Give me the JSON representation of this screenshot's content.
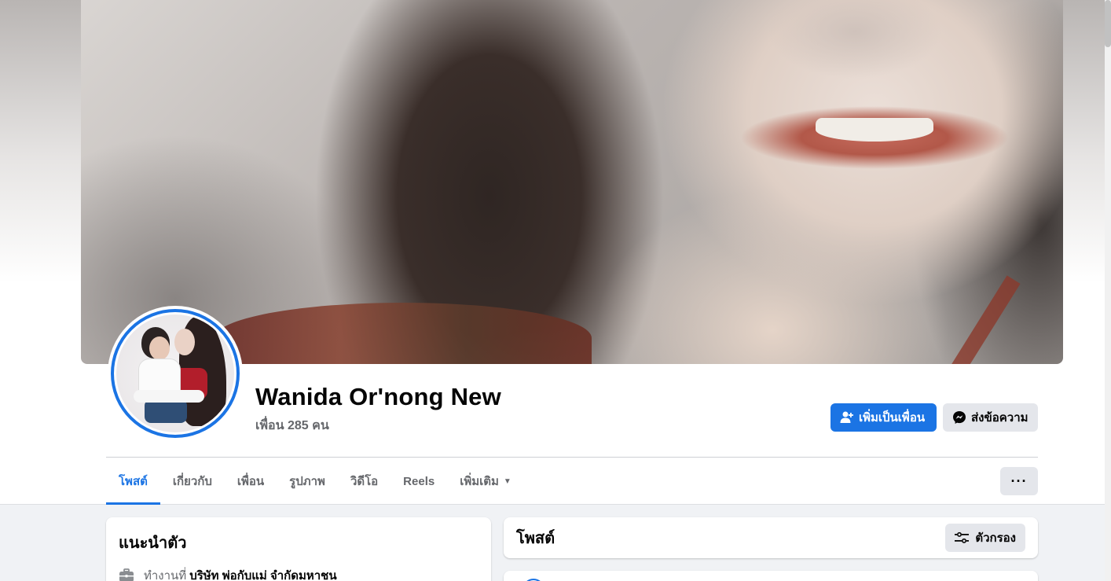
{
  "profile": {
    "name": "Wanida Or'nong New",
    "friend_count": "เพื่อน 285 คน"
  },
  "actions": {
    "add_friend_label": "เพิ่มเป็นเพื่อน",
    "message_label": "ส่งข้อความ",
    "more_label": "···"
  },
  "tabs": [
    {
      "label": "โพสต์",
      "active": true
    },
    {
      "label": "เกี่ยวกับ",
      "active": false
    },
    {
      "label": "เพื่อน",
      "active": false
    },
    {
      "label": "รูปภาพ",
      "active": false
    },
    {
      "label": "วิดีโอ",
      "active": false
    },
    {
      "label": "Reels",
      "active": false
    },
    {
      "label": "เพิ่มเติม",
      "active": false,
      "has_caret": true
    }
  ],
  "intro": {
    "title": "แนะนำตัว",
    "work_lead": "ทำงานที่",
    "work_place": "บริษัท พ่อกับแม่ จำกัดมหาชน",
    "work_icon": "briefcase-icon"
  },
  "posts": {
    "title": "โพสต์",
    "filter_label": "ตัวกรอง",
    "filter_icon": "sliders-icon"
  },
  "colors": {
    "accent": "#1b74e4",
    "button_grey": "#e4e6eb",
    "muted_text": "#65676b",
    "page_bg": "#f0f2f5"
  }
}
